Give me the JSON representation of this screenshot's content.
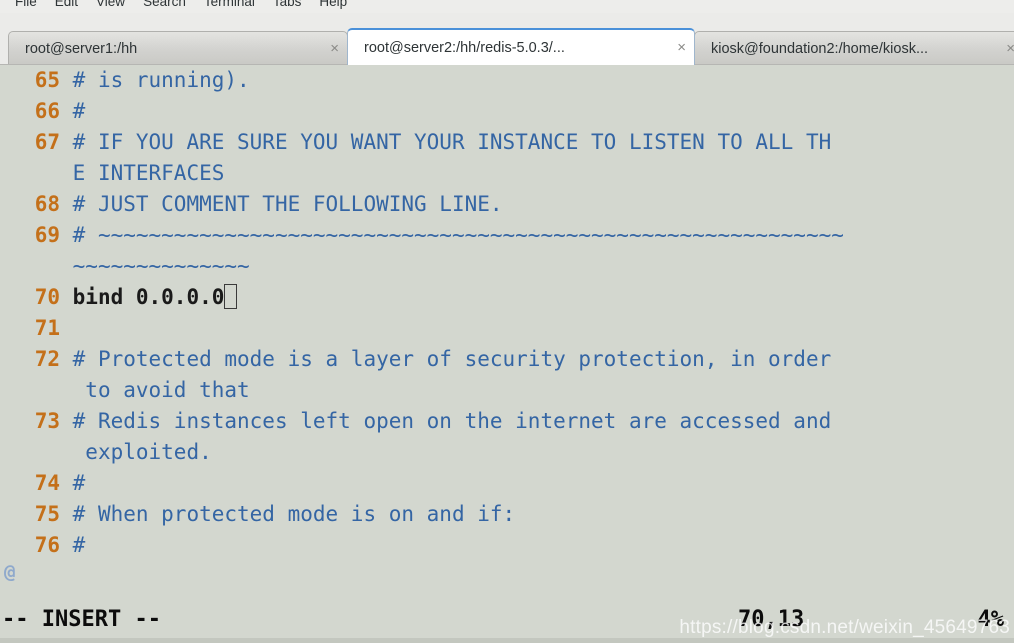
{
  "window": {
    "menu": [
      "File",
      "Edit",
      "View",
      "Search",
      "Terminal",
      "Tabs",
      "Help"
    ]
  },
  "tabs": [
    {
      "label": "root@server1:/hh",
      "close": "×",
      "active": false
    },
    {
      "label": "root@server2:/hh/redis-5.0.3/...",
      "close": "×",
      "active": true
    },
    {
      "label": "kiosk@foundation2:/home/kiosk...",
      "close": "×",
      "active": false
    }
  ],
  "editor": {
    "lines": [
      {
        "num": "65",
        "indent": "",
        "text": "# is running).",
        "kind": "comment"
      },
      {
        "num": "66",
        "indent": "",
        "text": "#",
        "kind": "comment"
      },
      {
        "num": "67",
        "indent": "",
        "text": "# IF YOU ARE SURE YOU WANT YOUR INSTANCE TO LISTEN TO ALL TH",
        "kind": "comment"
      },
      {
        "num": "",
        "indent": "",
        "text": "E INTERFACES",
        "kind": "comment"
      },
      {
        "num": "68",
        "indent": "",
        "text": "# JUST COMMENT THE FOLLOWING LINE.",
        "kind": "comment"
      },
      {
        "num": "69",
        "indent": "",
        "text": "# ~~~~~~~~~~~~~~~~~~~~~~~~~~~~~~~~~~~~~~~~~~~~~~~~~~~~~~~~~~~",
        "kind": "comment"
      },
      {
        "num": "",
        "indent": "",
        "text": "~~~~~~~~~~~~~~",
        "kind": "comment"
      },
      {
        "num": "70",
        "indent": "",
        "text": "bind 0.0.0.0",
        "kind": "code",
        "cursor": true
      },
      {
        "num": "71",
        "indent": "",
        "text": "",
        "kind": "comment"
      },
      {
        "num": "72",
        "indent": "",
        "text": "# Protected mode is a layer of security protection, in order",
        "kind": "comment"
      },
      {
        "num": "",
        "indent": "",
        "text": " to avoid that",
        "kind": "comment"
      },
      {
        "num": "73",
        "indent": "",
        "text": "# Redis instances left open on the internet are accessed and",
        "kind": "comment"
      },
      {
        "num": "",
        "indent": "",
        "text": " exploited.",
        "kind": "comment"
      },
      {
        "num": "74",
        "indent": "",
        "text": "#",
        "kind": "comment"
      },
      {
        "num": "75",
        "indent": "",
        "text": "# When protected mode is on and if:",
        "kind": "comment"
      },
      {
        "num": "76",
        "indent": "",
        "text": "#",
        "kind": "comment"
      }
    ],
    "filler_marker": "@"
  },
  "status": {
    "mode": "-- INSERT --",
    "position": "70,13",
    "percent": "4%"
  },
  "watermark": "https://blog.csdn.net/weixin_45649763",
  "colors": {
    "terminal_bg": "#d3d7cf",
    "comment": "#3465a4",
    "line_number": "#c4701a",
    "code": "#1a1a1a",
    "tab_active_border": "#4a90d9"
  }
}
